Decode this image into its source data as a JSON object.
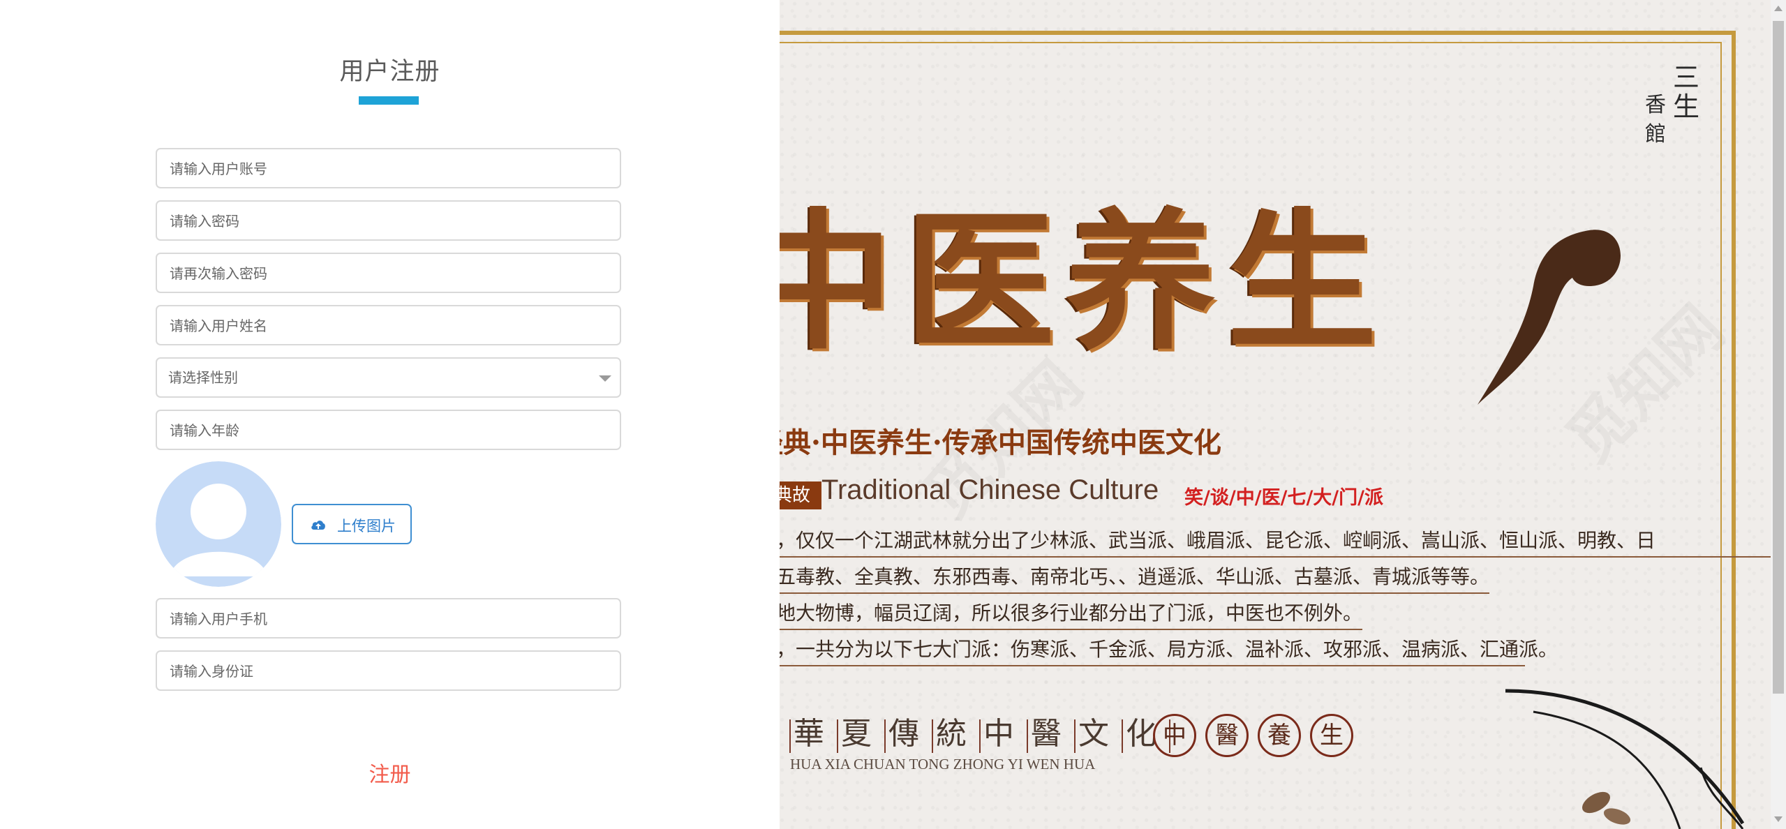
{
  "form": {
    "title": "用户注册",
    "account_placeholder": "请输入用户账号",
    "password_placeholder": "请输入密码",
    "confirm_password_placeholder": "请再次输入密码",
    "name_placeholder": "请输入用户姓名",
    "gender_placeholder": "请选择性别",
    "age_placeholder": "请输入年龄",
    "upload_label": "上传图片",
    "phone_placeholder": "请输入用户手机",
    "id_card_placeholder": "请输入身份证",
    "submit_label": "注册"
  },
  "colors": {
    "accent": "#1ea3d7",
    "submit": "#f25b4b",
    "upload": "#3f8fd2",
    "avatar_bg": "#c6dbf7"
  },
  "banner": {
    "main_title": "中医养生",
    "subtitle": "经典·中医养生·传承中国传统中医文化",
    "tag": "典故",
    "english_title": "Traditional Chinese Culture",
    "red_tag": "笑/谈/中/医/七/大/门/派",
    "paragraphs": [
      "，仅仅一个江湖武林就分出了少林派、武当派、峨眉派、昆仑派、崆峒派、嵩山派、恒山派、明教、日",
      "五毒教、全真教、东邪西毒、南帝北丐、、逍遥派、华山派、古墓派、青城派等等。",
      "地大物博，幅员辽阔，所以很多行业都分出了门派，中医也不例外。",
      "，一共分为以下七大门派：伤寒派、千金派、局方派、温补派、攻邪派、温病派、汇通派。"
    ],
    "heritage_chars": [
      "華",
      "夏",
      "傳",
      "統",
      "中",
      "醫",
      "文",
      "化"
    ],
    "heritage_pinyin": "HUA XIA CHUAN TONG ZHONG YI WEN HUA",
    "seal_chars": [
      "中",
      "醫",
      "養",
      "生"
    ],
    "side_text_cols": [
      "三生",
      "香館"
    ]
  }
}
